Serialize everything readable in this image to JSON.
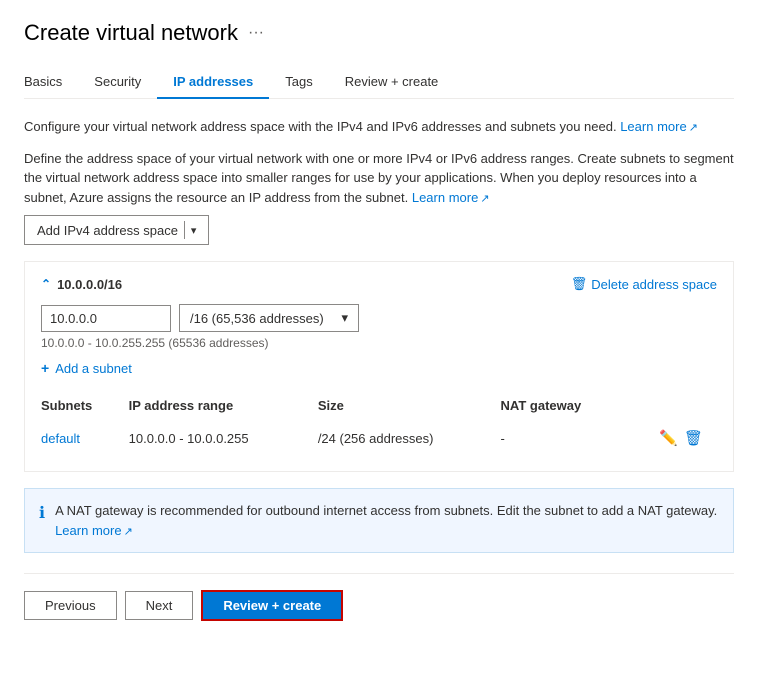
{
  "page": {
    "title": "Create virtual network",
    "more_icon": "···"
  },
  "tabs": [
    {
      "id": "basics",
      "label": "Basics",
      "active": false
    },
    {
      "id": "security",
      "label": "Security",
      "active": false
    },
    {
      "id": "ip-addresses",
      "label": "IP addresses",
      "active": true
    },
    {
      "id": "tags",
      "label": "Tags",
      "active": false
    },
    {
      "id": "review-create",
      "label": "Review + create",
      "active": false
    }
  ],
  "descriptions": {
    "line1_pre": "Configure your virtual network address space with the IPv4 and IPv6 addresses and subnets you need.",
    "line1_link": "Learn more",
    "line2": "Define the address space of your virtual network with one or more IPv4 or IPv6 address ranges. Create subnets to segment the virtual network address space into smaller ranges for use by your applications. When you deploy resources into a subnet, Azure assigns the resource an IP address from the subnet.",
    "line2_link": "Learn more"
  },
  "add_button": {
    "label": "Add IPv4 address space",
    "icon": "|"
  },
  "address_space": {
    "title": "10.0.0.0/16",
    "chevron": "⌃",
    "delete_label": "Delete address space",
    "delete_icon": "🗑",
    "ip_value": "10.0.0.0",
    "cidr_value": "/16 (65,536 addresses)",
    "range_hint": "10.0.0.0 - 10.0.255.255 (65536 addresses)",
    "add_subnet_label": "Add a subnet"
  },
  "subnets_table": {
    "headers": [
      "Subnets",
      "IP address range",
      "Size",
      "NAT gateway"
    ],
    "rows": [
      {
        "name": "default",
        "ip_range": "10.0.0.0 - 10.0.0.255",
        "size": "/24 (256 addresses)",
        "nat_gateway": "-"
      }
    ]
  },
  "nat_info": {
    "text": "A NAT gateway is recommended for outbound internet access from subnets. Edit the subnet to add a NAT gateway.",
    "learn_more": "Learn more"
  },
  "footer": {
    "previous": "Previous",
    "next": "Next",
    "review_create": "Review + create"
  }
}
